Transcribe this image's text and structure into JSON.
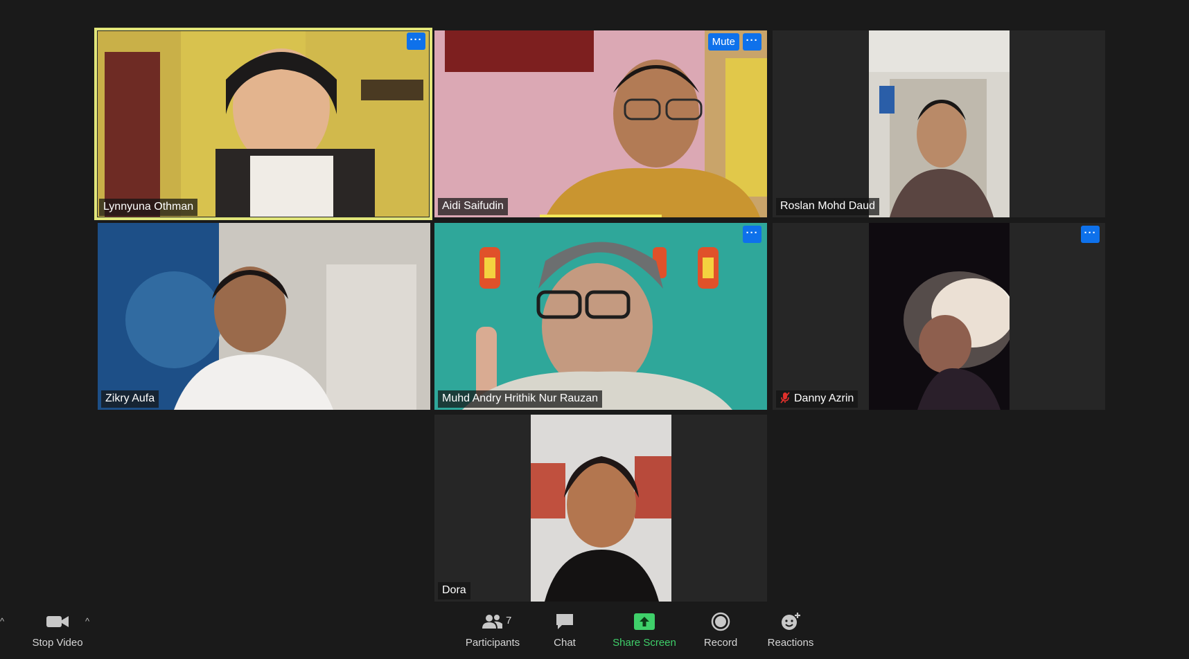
{
  "participants": [
    {
      "name": "Lynnyuna Othman",
      "muted": false,
      "active_speaker": true
    },
    {
      "name": "Aidi Saifudin",
      "muted": false,
      "has_mute_button": true,
      "mute_label": "Mute"
    },
    {
      "name": "Roslan Mohd Daud",
      "muted": false
    },
    {
      "name": "Zikry Aufa",
      "muted": false
    },
    {
      "name": "Muhd Andry Hrithik Nur Rauzan",
      "muted": false
    },
    {
      "name": "Danny Azrin",
      "muted": true
    },
    {
      "name": "Dora",
      "muted": false
    }
  ],
  "more_label": "···",
  "toolbar": {
    "stop_video": "Stop Video",
    "participants": "Participants",
    "participants_count": "7",
    "chat": "Chat",
    "share_screen": "Share Screen",
    "record": "Record",
    "reactions": "Reactions",
    "caret": "^"
  },
  "colors": {
    "background": "#1a1a1a",
    "tile": "#262626",
    "accent_blue": "#0e71eb",
    "active_border": "#e2e67a",
    "speaking_bar": "#f3e85a",
    "share_green": "#3fd06a",
    "muted_red": "#e0302b"
  }
}
